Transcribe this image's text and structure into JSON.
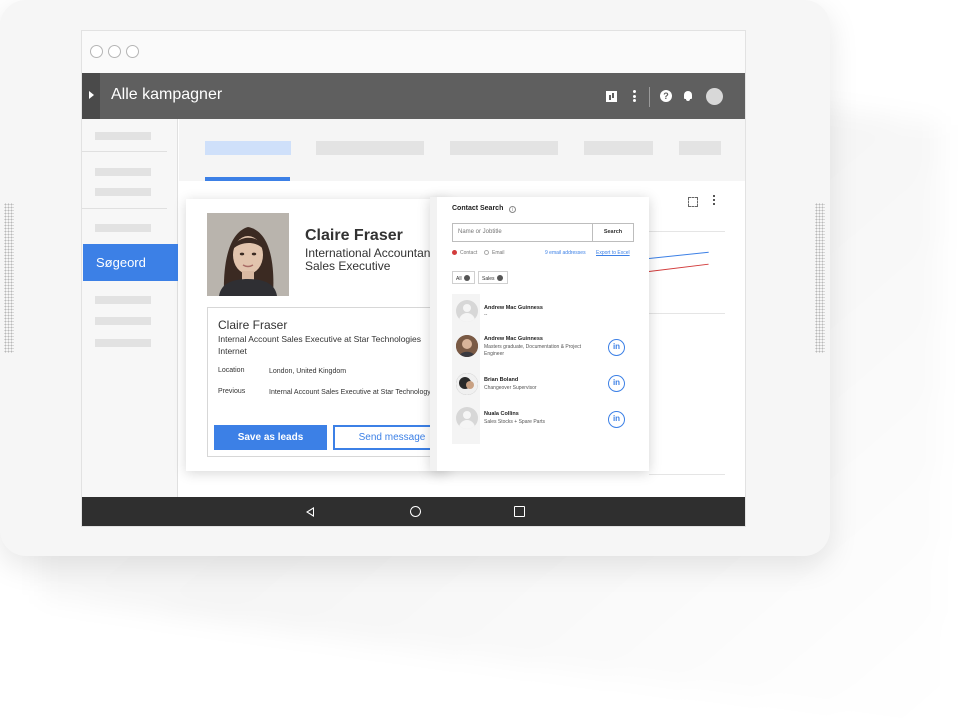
{
  "app": {
    "title": "Alle kampagner",
    "colors": {
      "accent": "#3c80e6",
      "appbar": "#5f5f5f",
      "navbar": "#2f2f2f"
    },
    "appbar_icons": [
      "bar-chart-icon",
      "more-vert-icon",
      "help-icon",
      "bell-icon",
      "avatar"
    ]
  },
  "sidebar": {
    "active_item": "Søgeord"
  },
  "profile": {
    "name": "Claire Fraser",
    "role_line1": "International Accountant",
    "role_line2": "Sales Executive",
    "detail": {
      "name": "Claire Fraser",
      "headline": "Internal Account Sales Executive at Star Technologies Internet",
      "location_label": "Location",
      "location_value": "London, United Kingdom",
      "previous_label": "Previous",
      "previous_value": "Internal Account Sales Executive at Star Technology"
    },
    "save_button": "Save as leads",
    "send_button": "Send message"
  },
  "contact_search": {
    "title": "Contact Search",
    "input_placeholder": "Name or Jobtitle",
    "search_button": "Search",
    "radio_contact": "Contact",
    "radio_email": "Email",
    "email_count": "9 email addresses",
    "export_link": "Export to Excel",
    "filter_all": "All",
    "filter_sales": "Sales",
    "results": [
      {
        "name": "Andrew Mac Guinness",
        "description": "--",
        "linkedin": false
      },
      {
        "name": "Andrew Mac Guinness",
        "description": "Masters graduate, Documentation & Project Engineer",
        "linkedin": true
      },
      {
        "name": "Brian Boland",
        "description": "Changeover Supervisor",
        "linkedin": true
      },
      {
        "name": "Nuala Collins",
        "description": "Sales Stocks + Spare Parts",
        "linkedin": true
      }
    ],
    "linkedin_label": "in"
  }
}
